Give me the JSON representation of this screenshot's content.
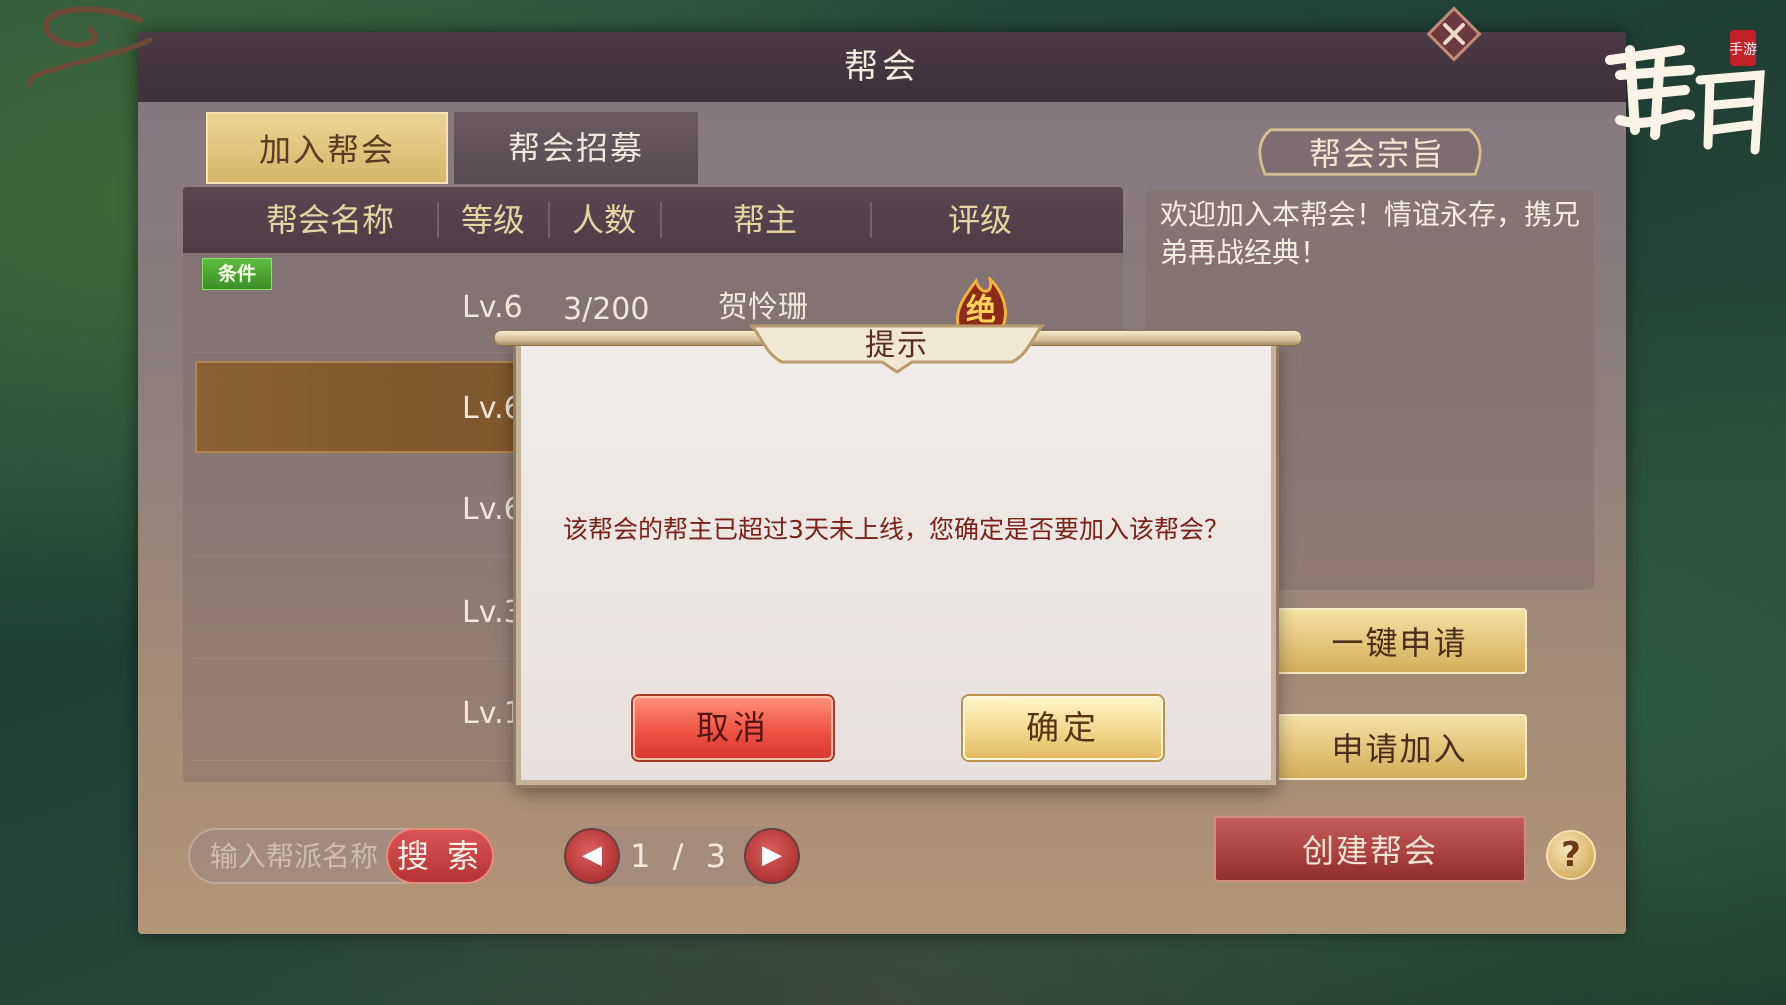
{
  "window": {
    "title": "帮会"
  },
  "tabs": [
    {
      "label": "加入帮会",
      "active": true
    },
    {
      "label": "帮会招募",
      "active": false
    }
  ],
  "table": {
    "headers": [
      "帮会名称",
      "等级",
      "人数",
      "帮主",
      "评级"
    ],
    "condition_badge": "条件",
    "rows": [
      {
        "level": "Lv.6",
        "members": "3/200",
        "leader": "贺怜珊",
        "rank": "绝"
      },
      {
        "level": "Lv.6"
      },
      {
        "level": "Lv.6"
      },
      {
        "level": "Lv.3"
      },
      {
        "level": "Lv.1"
      }
    ]
  },
  "purpose": {
    "title": "帮会宗旨",
    "text": "欢迎加入本帮会！情谊永存，携兄弟再战经典！"
  },
  "buttons": {
    "one_click_apply": "一键申请",
    "apply_join": "申请加入",
    "create": "创建帮会",
    "help": "?"
  },
  "search": {
    "placeholder": "输入帮派名称",
    "button": "搜 索"
  },
  "pager": {
    "current": "1",
    "total": "3",
    "text": "1 / 3"
  },
  "dialog": {
    "title": "提示",
    "message": "该帮会的帮主已超过3天未上线，您确定是否要加入该帮会？",
    "cancel": "取消",
    "confirm": "确定"
  },
  "colors": {
    "accent_gold": "#e3c47a",
    "accent_red": "#d8382f",
    "header_text": "#e8d3a2",
    "dialog_text": "#7a2218"
  }
}
